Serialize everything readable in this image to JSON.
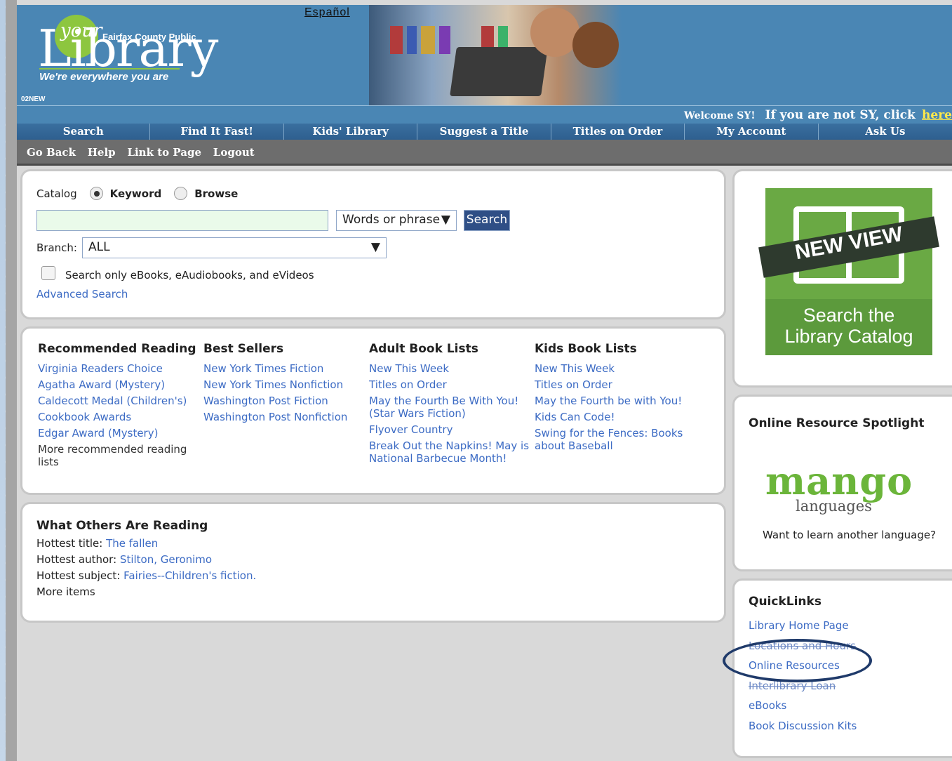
{
  "header": {
    "logo_your": "your",
    "logo_library": "Library",
    "logo_fairfax": "Fairfax County Public",
    "logo_tagline": "We're everywhere you are",
    "code": "02NEW",
    "espanol": "Español"
  },
  "welcome": {
    "greeting": "Welcome SY!",
    "prompt": "If you are not SY, click",
    "here": "here"
  },
  "nav": [
    "Search",
    "Find It Fast!",
    "Kids' Library",
    "Suggest a Title",
    "Titles on Order",
    "My Account",
    "Ask Us"
  ],
  "subnav": [
    "Go Back",
    "Help",
    "Link to Page",
    "Logout"
  ],
  "catalog": {
    "label": "Catalog",
    "keyword": "Keyword",
    "browse": "Browse",
    "search_value": "",
    "match_value": "Words or phrase",
    "search_button": "Search",
    "branch_label": "Branch:",
    "branch_value": "ALL",
    "eonly_label": "Search only eBooks, eAudiobooks, and eVideos",
    "advanced": "Advanced Search"
  },
  "lists": {
    "recommended": {
      "title": "Recommended Reading",
      "items": [
        "Virginia Readers Choice",
        "Agatha Award (Mystery)",
        "Caldecott Medal (Children's)",
        "Cookbook Awards",
        "Edgar Award (Mystery)"
      ],
      "more": "More recommended reading lists"
    },
    "bestsellers": {
      "title": "Best Sellers",
      "items": [
        "New York Times Fiction",
        "New York Times Nonfiction",
        "Washington Post Fiction",
        "Washington Post Nonfiction"
      ]
    },
    "adult": {
      "title": "Adult Book Lists",
      "items": [
        "New This Week",
        "Titles on Order",
        "May the Fourth Be With You! (Star Wars Fiction)",
        "Flyover Country",
        "Break Out the Napkins! May is National Barbecue Month!"
      ]
    },
    "kids": {
      "title": "Kids Book Lists",
      "items": [
        "New This Week",
        "Titles on Order",
        "May the Fourth be with You!",
        "Kids Can Code!",
        "Swing for the Fences: Books about Baseball"
      ]
    }
  },
  "others": {
    "title": "What Others Are Reading",
    "title_label": "Hottest title:",
    "title_value": "The fallen",
    "author_label": "Hottest author:",
    "author_value": "Stilton, Geronimo",
    "subject_label": "Hottest subject:",
    "subject_value": "Fairies--Children's fiction.",
    "more": "More items"
  },
  "newview": {
    "banner": "NEW VIEW",
    "caption_line1": "Search the",
    "caption_line2": "Library Catalog"
  },
  "spotlight": {
    "title": "Online Resource Spotlight",
    "logo_word": "mango",
    "logo_sub": "languages",
    "desc": "Want to learn another language?"
  },
  "quicklinks": {
    "title": "QuickLinks",
    "items": [
      "Library Home Page",
      "Locations and Hours",
      "Online Resources",
      "Interlibrary Loan",
      "eBooks",
      "Book Discussion Kits"
    ]
  },
  "colors": {
    "header_blue": "#4a86b4",
    "nav_blue": "#2e5f8f",
    "link_blue": "#3c6bc4",
    "here_yellow": "#ffe94a",
    "search_button": "#2f4f86",
    "brand_green": "#6aa944",
    "annotation_circle": "#1f3a6a"
  }
}
